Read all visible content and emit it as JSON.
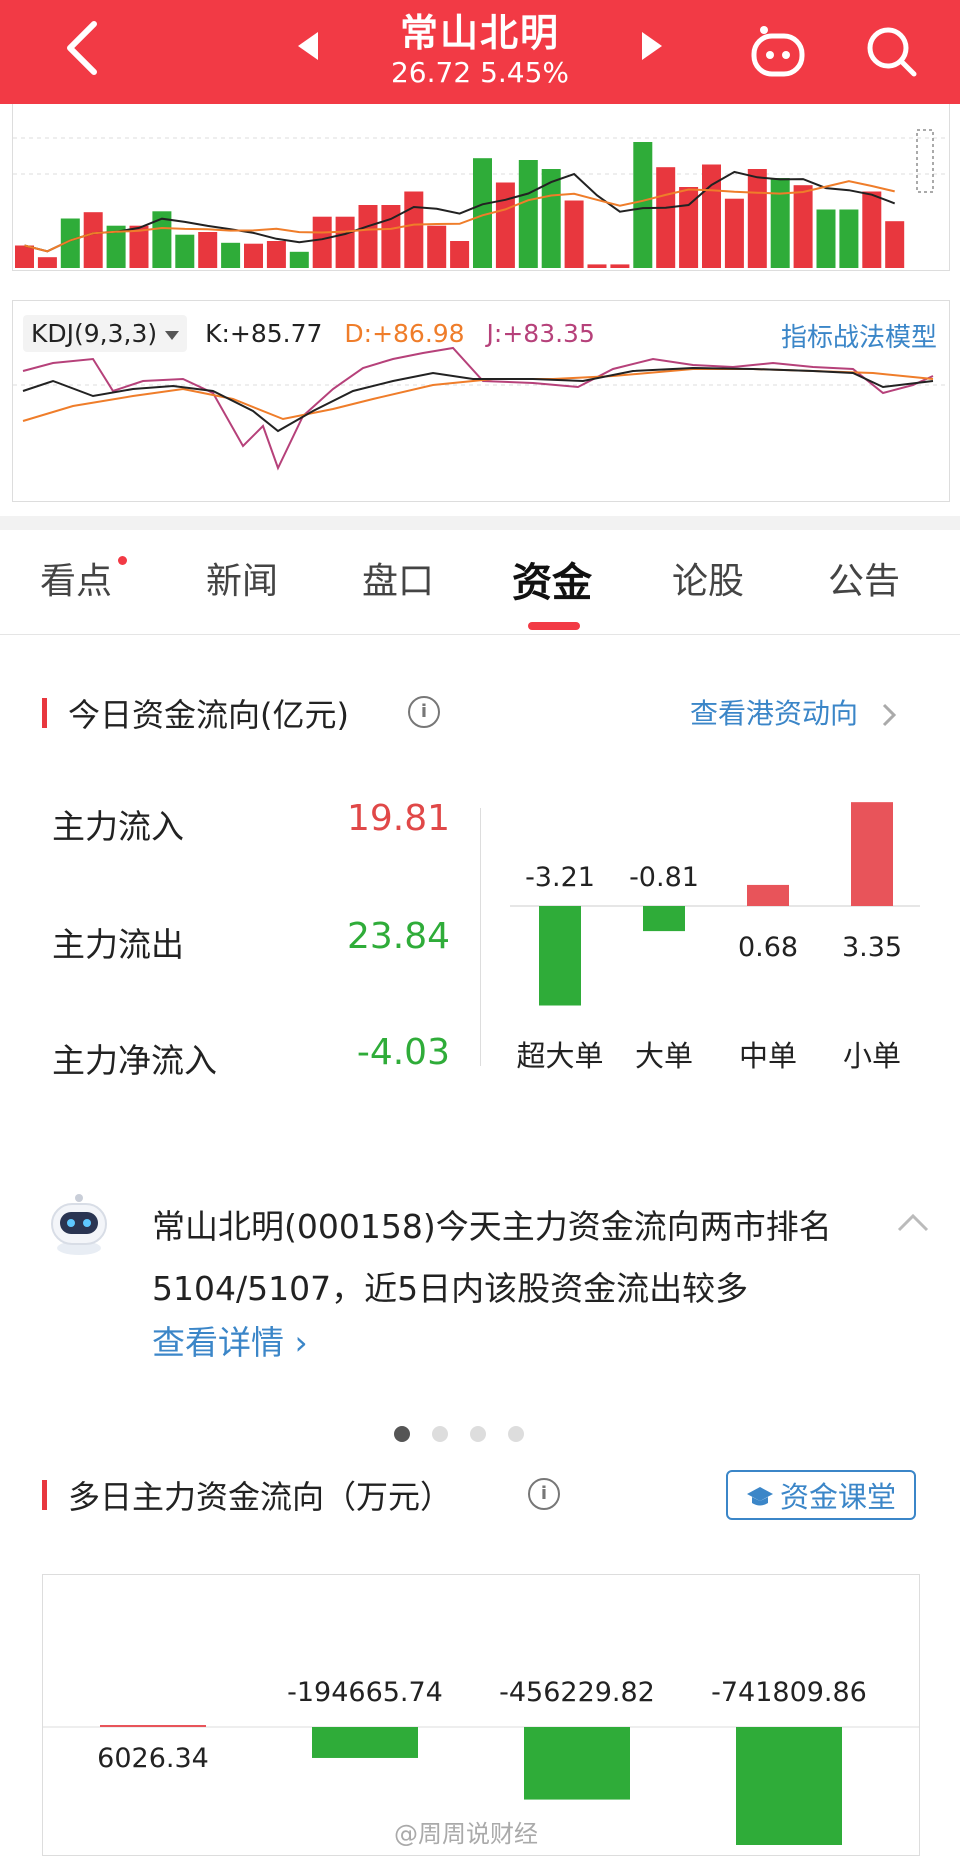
{
  "header": {
    "title": "常山北明",
    "price": "26.72",
    "change_pct": "5.45%",
    "bg_color": "#f23a45"
  },
  "volume_chart": {
    "up_color": "#e8373e",
    "down_color": "#2fac39",
    "bars": [
      {
        "v": 0.25,
        "c": "up"
      },
      {
        "v": 0.12,
        "c": "up"
      },
      {
        "v": 0.55,
        "c": "down"
      },
      {
        "v": 0.62,
        "c": "up"
      },
      {
        "v": 0.47,
        "c": "down"
      },
      {
        "v": 0.47,
        "c": "up"
      },
      {
        "v": 0.63,
        "c": "down"
      },
      {
        "v": 0.37,
        "c": "down"
      },
      {
        "v": 0.4,
        "c": "up"
      },
      {
        "v": 0.28,
        "c": "down"
      },
      {
        "v": 0.27,
        "c": "up"
      },
      {
        "v": 0.3,
        "c": "up"
      },
      {
        "v": 0.18,
        "c": "down"
      },
      {
        "v": 0.57,
        "c": "up"
      },
      {
        "v": 0.57,
        "c": "up"
      },
      {
        "v": 0.7,
        "c": "up"
      },
      {
        "v": 0.7,
        "c": "up"
      },
      {
        "v": 0.85,
        "c": "up"
      },
      {
        "v": 0.47,
        "c": "up"
      },
      {
        "v": 0.3,
        "c": "up"
      },
      {
        "v": 1.22,
        "c": "down"
      },
      {
        "v": 0.95,
        "c": "up"
      },
      {
        "v": 1.2,
        "c": "down"
      },
      {
        "v": 1.1,
        "c": "down"
      },
      {
        "v": 0.75,
        "c": "up"
      },
      {
        "v": 0.04,
        "c": "up"
      },
      {
        "v": 0.04,
        "c": "up"
      },
      {
        "v": 1.4,
        "c": "down"
      },
      {
        "v": 1.12,
        "c": "up"
      },
      {
        "v": 0.9,
        "c": "up"
      },
      {
        "v": 1.15,
        "c": "up"
      },
      {
        "v": 0.77,
        "c": "up"
      },
      {
        "v": 1.1,
        "c": "up"
      },
      {
        "v": 1.0,
        "c": "down"
      },
      {
        "v": 0.92,
        "c": "up"
      },
      {
        "v": 0.65,
        "c": "down"
      },
      {
        "v": 0.65,
        "c": "down"
      },
      {
        "v": 0.85,
        "c": "up"
      },
      {
        "v": 0.52,
        "c": "up"
      }
    ]
  },
  "kdj": {
    "selector": "KDJ(9,3,3)",
    "k_label": "K:+85.77",
    "d_label": "D:+86.98",
    "j_label": "J:+83.35",
    "link": "指标战法模型",
    "colors": {
      "k": "#222222",
      "d": "#ef7d2a",
      "j": "#b6417a"
    }
  },
  "tabs": [
    {
      "label": "看点",
      "badge": true
    },
    {
      "label": "新闻"
    },
    {
      "label": "盘口"
    },
    {
      "label": "资金",
      "active": true
    },
    {
      "label": "论股"
    },
    {
      "label": "公告"
    }
  ],
  "today_flow": {
    "title": "今日资金流向(亿元)",
    "link": "查看港资动向",
    "rows": [
      {
        "label": "主力流入",
        "value": "19.81",
        "color": "#e04848"
      },
      {
        "label": "主力流出",
        "value": "23.84",
        "color": "#2fac39"
      },
      {
        "label": "主力净流入",
        "value": "-4.03",
        "color": "#2fac39"
      }
    ],
    "bars": [
      {
        "label": "超大单",
        "value": -3.21,
        "text": "-3.21"
      },
      {
        "label": "大单",
        "value": -0.81,
        "text": "-0.81"
      },
      {
        "label": "中单",
        "value": 0.68,
        "text": "0.68"
      },
      {
        "label": "小单",
        "value": 3.35,
        "text": "3.35"
      }
    ]
  },
  "ai_summary": {
    "text": "常山北明(000158)今天主力资金流向两市排名5104/5107，近5日内该股资金流出较多",
    "link": "查看详情 ›"
  },
  "multi_day": {
    "title": "多日主力资金流向（万元）",
    "button": "资金课堂",
    "bars": [
      {
        "value": 6026.34,
        "text": "6026.34"
      },
      {
        "value": -194665.74,
        "text": "-194665.74"
      },
      {
        "value": -456229.82,
        "text": "-456229.82"
      },
      {
        "value": -741809.86,
        "text": "-741809.86"
      }
    ]
  },
  "watermark": "@周周说财经",
  "chart_data": [
    {
      "type": "bar",
      "categories": [
        "超大单",
        "大单",
        "中单",
        "小单"
      ],
      "values": [
        -3.21,
        -0.81,
        0.68,
        3.35
      ]
    },
    {
      "type": "bar",
      "values": [
        6026.34,
        -194665.74,
        -456229.82,
        -741809.86
      ]
    }
  ]
}
